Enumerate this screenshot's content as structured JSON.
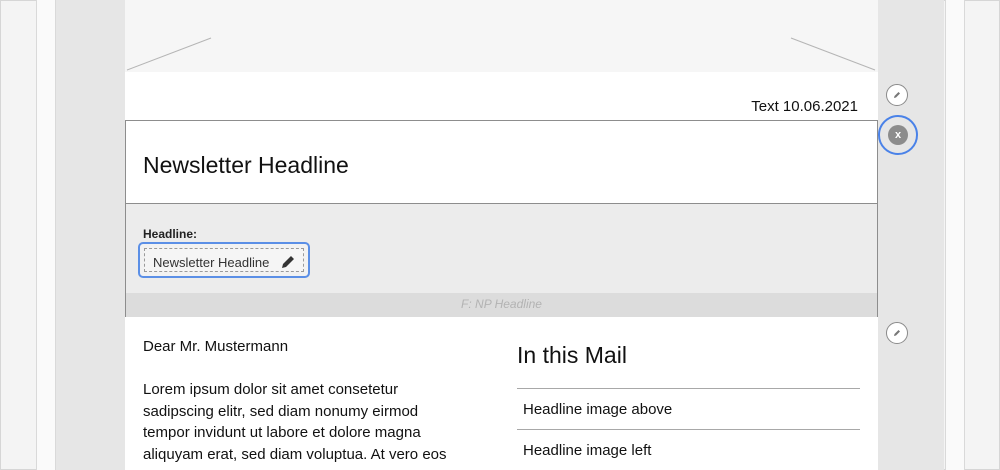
{
  "mail": {
    "date_text": "Text 10.06.2021",
    "greeting": "Dear Mr. Mustermann",
    "body_text": "Lorem ipsum dolor sit amet consetetur sadipscing elitr, sed diam nonumy eirmod tempor invidunt ut labore et dolore magna aliquyam erat, sed diam voluptua. At vero eos"
  },
  "headline_module": {
    "title": "Newsletter Headline",
    "field_label": "Headline:",
    "field_value": "Newsletter Headline",
    "module_name": "F: NP Headline"
  },
  "toc": {
    "title": "In this Mail",
    "items": [
      {
        "label": "Headline image above"
      },
      {
        "label": "Headline image left"
      }
    ]
  },
  "controls": {
    "close_label": "x",
    "accent_color": "#4a82e8"
  },
  "icons": [
    "pencil-icon",
    "close-icon",
    "edit-icon"
  ]
}
